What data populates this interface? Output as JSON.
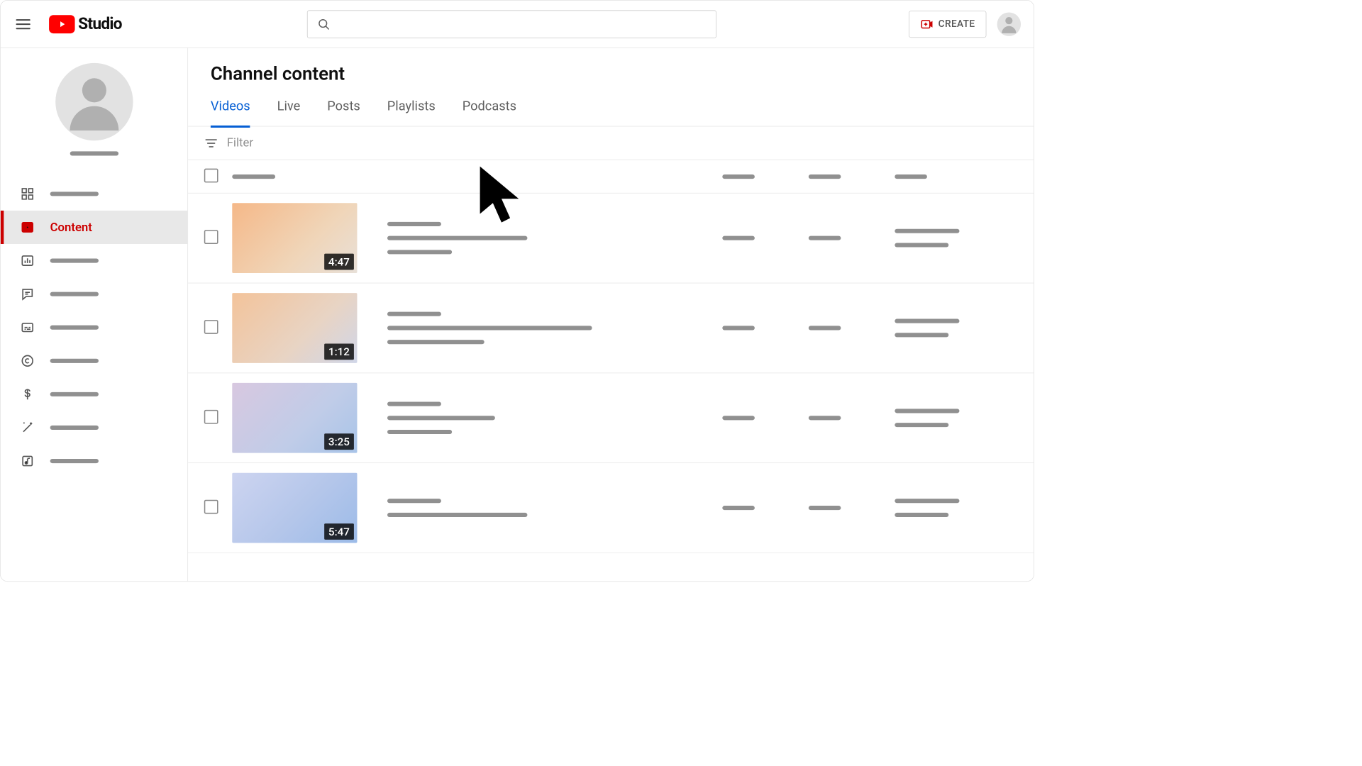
{
  "header": {
    "logo_text": "Studio",
    "search_placeholder": "",
    "create_label": "CREATE"
  },
  "sidebar": {
    "items": [
      {
        "key": "dashboard",
        "icon": "grid-icon",
        "label": ""
      },
      {
        "key": "content",
        "icon": "play-square-icon",
        "label": "Content",
        "active": true
      },
      {
        "key": "analytics",
        "icon": "bar-chart-icon",
        "label": ""
      },
      {
        "key": "comments",
        "icon": "comment-icon",
        "label": ""
      },
      {
        "key": "subtitles",
        "icon": "subtitles-icon",
        "label": ""
      },
      {
        "key": "copyright",
        "icon": "copyright-icon",
        "label": ""
      },
      {
        "key": "earn",
        "icon": "dollar-icon",
        "label": ""
      },
      {
        "key": "customization",
        "icon": "magic-wand-icon",
        "label": ""
      },
      {
        "key": "audio",
        "icon": "music-note-icon",
        "label": ""
      }
    ]
  },
  "main": {
    "page_title": "Channel content",
    "tabs": [
      {
        "label": "Videos",
        "active": true
      },
      {
        "label": "Live"
      },
      {
        "label": "Posts"
      },
      {
        "label": "Playlists"
      },
      {
        "label": "Podcasts"
      }
    ],
    "filter_label": "Filter",
    "rows": [
      {
        "duration": "4:47",
        "thumb": "A"
      },
      {
        "duration": "1:12",
        "thumb": "B"
      },
      {
        "duration": "3:25",
        "thumb": "C"
      },
      {
        "duration": "5:47",
        "thumb": "D"
      }
    ]
  }
}
